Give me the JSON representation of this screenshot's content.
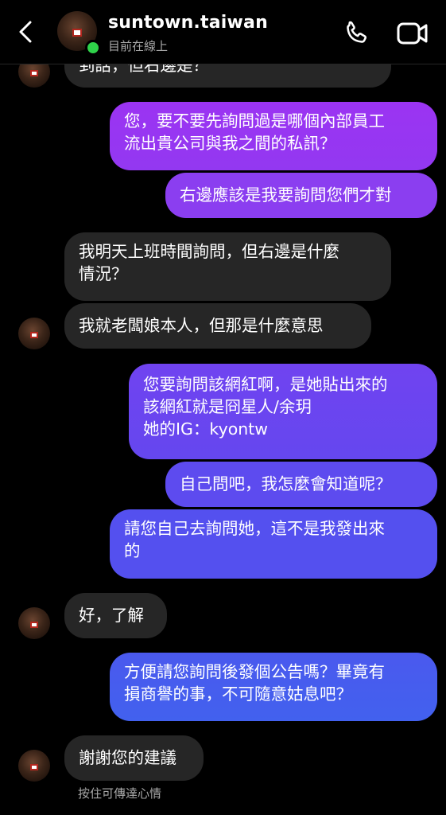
{
  "header": {
    "username": "suntown.taiwan",
    "status": "目前在線上",
    "icons": {
      "back": "chevron-left-icon",
      "call": "phone-icon",
      "video": "video-camera-icon"
    }
  },
  "colors": {
    "background": "#000000",
    "received_bubble": "#262626",
    "sent_gradient_top": "#9b34f2",
    "sent_gradient_bottom": "#3f63ef",
    "online": "#2fd24a"
  },
  "messages": [
    {
      "side": "received",
      "text": "到話，但右邊是？"
    },
    {
      "side": "sent",
      "text": "您，要不要先詢問過是哪個內部員工\n流出貴公司與我之間的私訊？"
    },
    {
      "side": "sent",
      "text": "右邊應該是我要詢問您們才對"
    },
    {
      "side": "received",
      "text": "我明天上班時間詢問，但右邊是什麼\n情況？"
    },
    {
      "side": "received",
      "text": "我就老闆娘本人，但那是什麼意思"
    },
    {
      "side": "sent",
      "text": "您要詢問該網紅啊，是她貼出來的\n該網紅就是冏星人/余玥\n她的IG：kyontw"
    },
    {
      "side": "sent",
      "text": "自己問吧，我怎麼會知道呢？"
    },
    {
      "side": "sent",
      "text": "請您自己去詢問她，這不是我發出來\n的"
    },
    {
      "side": "received",
      "text": "好，了解"
    },
    {
      "side": "sent",
      "text": "方便請您詢問後發個公告嗎？畢竟有\n損商譽的事，不可隨意姑息吧？"
    },
    {
      "side": "received",
      "text": "謝謝您的建議"
    }
  ],
  "footer_hint": "按住可傳達心情"
}
